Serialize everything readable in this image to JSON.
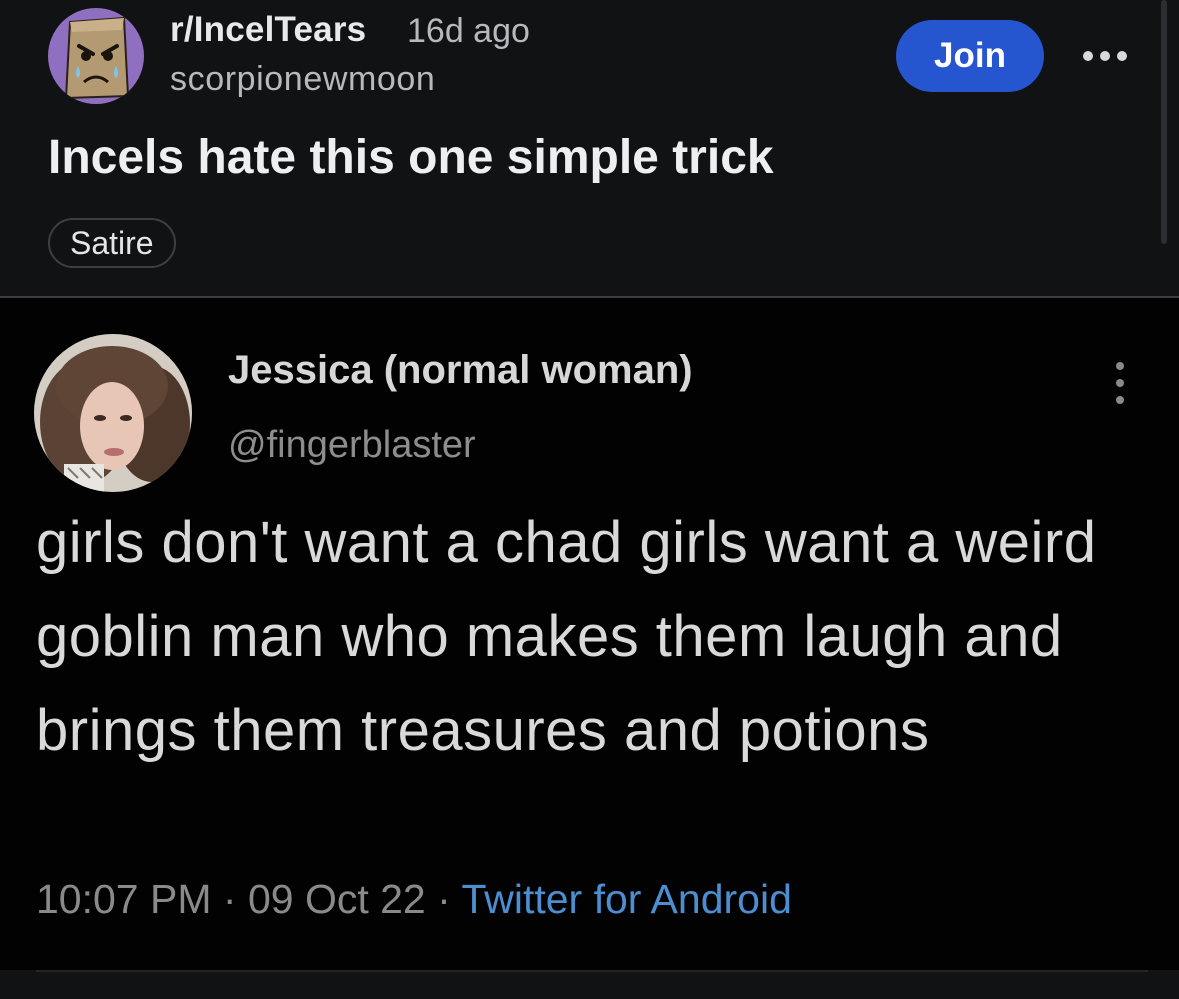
{
  "post": {
    "subreddit": "r/IncelTears",
    "age": "16d ago",
    "author": "scorpionewmoon",
    "join_label": "Join",
    "title": "Incels hate this one simple trick",
    "flair": "Satire"
  },
  "tweet": {
    "display_name": "Jessica (normal woman)",
    "handle": "@fingerblaster",
    "text": "girls don't want a chad girls want a weird goblin man who makes them laugh and brings them treasures and potions",
    "time": "10:07 PM",
    "date": "09 Oct 22",
    "source": "Twitter for Android"
  },
  "icons": {
    "subreddit_avatar": "paper-bag-face-icon",
    "post_menu": "more-horizontal-icon",
    "tweet_menu": "more-vertical-icon"
  },
  "colors": {
    "background": "#111214",
    "join_button": "#2556cf",
    "tweet_background": "#020202",
    "tweet_source_link": "#4b8ed1"
  }
}
